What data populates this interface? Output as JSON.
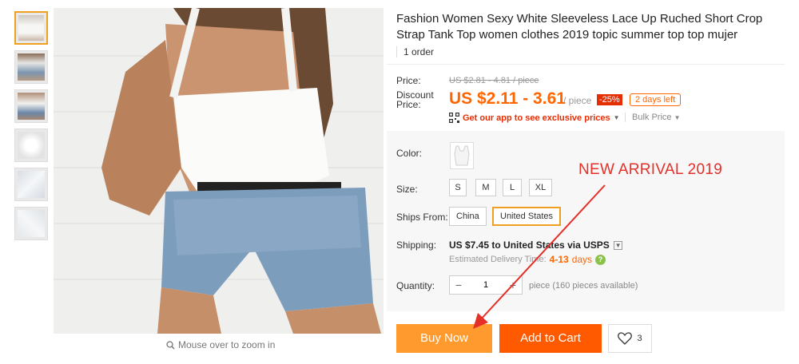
{
  "product": {
    "title": "Fashion Women Sexy White Sleeveless Lace Up Ruched Short Crop Strap Tank Top women clothes 2019 topic summer top top mujer",
    "orders": "1 order"
  },
  "gallery": {
    "zoom_hint": "Mouse over to zoom in",
    "thumb_count": 6,
    "active_thumb": 0
  },
  "price": {
    "price_label": "Price:",
    "old_price": "US $2.81 - 4.81 / piece",
    "discount_label": "Discount\nPrice:",
    "current_price": "US $2.11 - 3.61",
    "per_unit": "/ piece",
    "discount_badge": "-25%",
    "days_left": "2 days left",
    "app_promo": "Get our app to see exclusive prices",
    "bulk_price": "Bulk Price"
  },
  "options": {
    "color_label": "Color:",
    "size_label": "Size:",
    "sizes": [
      "S",
      "M",
      "L",
      "XL"
    ],
    "ships_from_label": "Ships From:",
    "ships_from": [
      "China",
      "United States"
    ],
    "ships_from_selected": "United States"
  },
  "shipping": {
    "label": "Shipping:",
    "cost": "US $7.45",
    "destination": "to United States via USPS",
    "delivery_label": "Estimated Delivery Time:",
    "delivery_days": "4-13",
    "delivery_unit": "days"
  },
  "quantity": {
    "label": "Quantity:",
    "value": "1",
    "minus": "−",
    "plus": "+",
    "note": "piece (160 pieces available)"
  },
  "actions": {
    "buy_now": "Buy Now",
    "add_to_cart": "Add to Cart",
    "wishlist_count": "3"
  },
  "annotation": {
    "text": "NEW ARRIVAL 2019"
  },
  "colors": {
    "accent_orange": "#ff6600",
    "buy_now": "#ff9a2e",
    "add_to_cart": "#ff5a00",
    "badge_red": "#e62e04",
    "annotation_red": "#e5302a",
    "selected_border": "#f0a020"
  },
  "icons": {
    "zoom": "magnifier-icon",
    "qr": "qr-code-icon",
    "help": "question-icon",
    "heart": "heart-icon"
  }
}
